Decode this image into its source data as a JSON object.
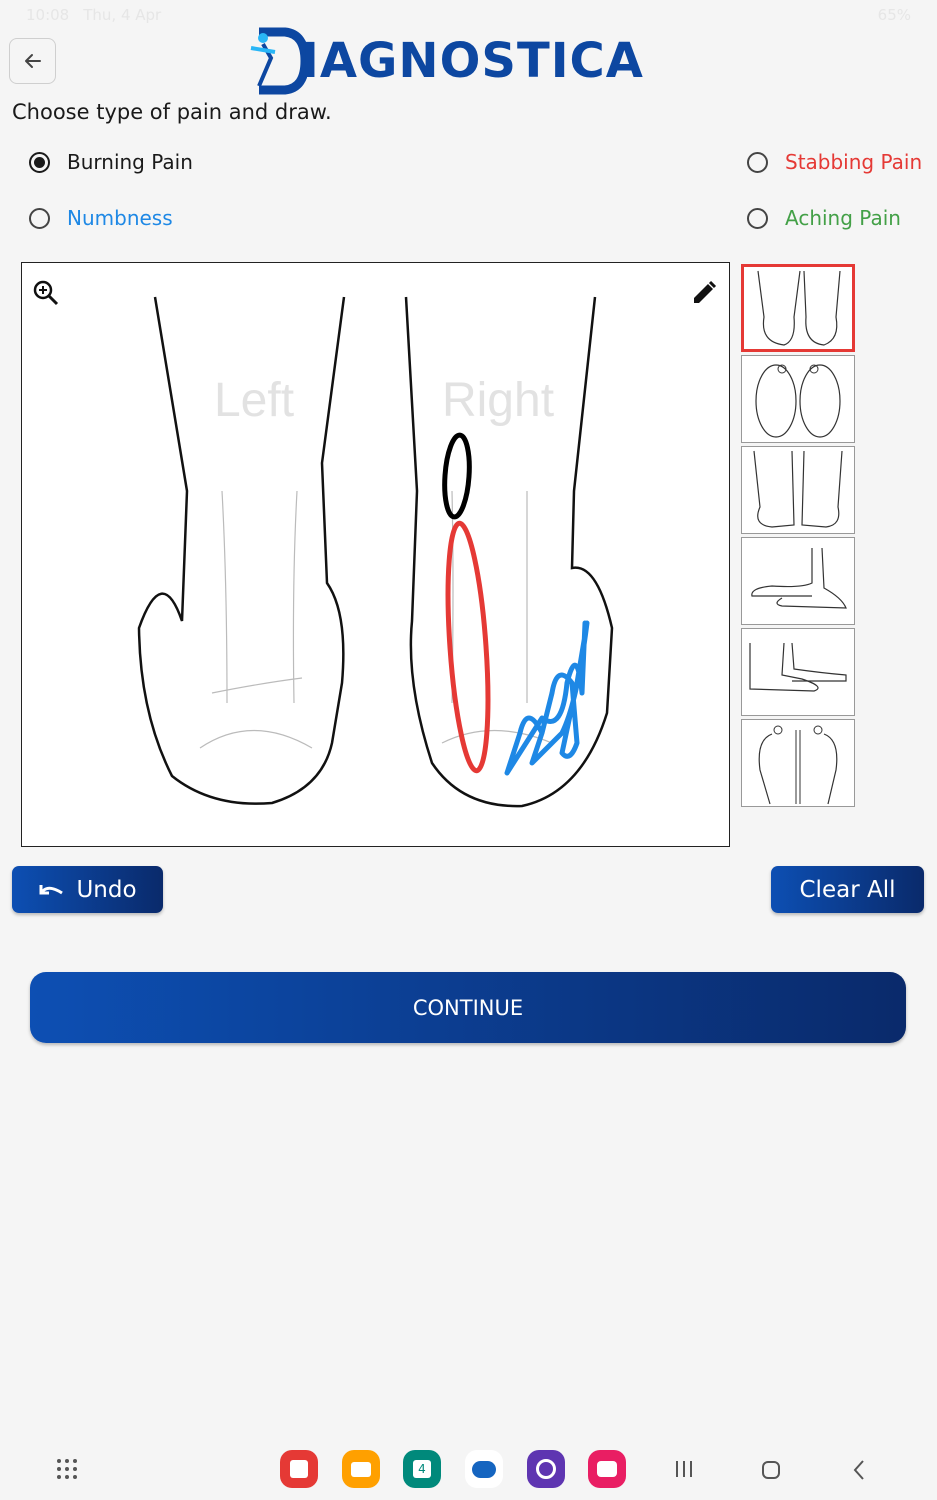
{
  "status_bar": {
    "time": "10:08",
    "date": "Thu, 4 Apr",
    "battery": "65%"
  },
  "header": {
    "logo_text": "IAGNOSTICA",
    "brand_color": "#0d47a1"
  },
  "instruction": "Choose type of pain and draw.",
  "pain_types": [
    {
      "label": "Burning Pain",
      "color": "#1a1a1a",
      "selected": true
    },
    {
      "label": "Stabbing Pain",
      "color": "#e53935",
      "selected": false
    },
    {
      "label": "Numbness",
      "color": "#1e88e5",
      "selected": false
    },
    {
      "label": "Aching Pain",
      "color": "#43a047",
      "selected": false
    }
  ],
  "canvas": {
    "left_label": "Left",
    "right_label": "Right",
    "zoom_icon": "zoom-in-icon",
    "pen_icon": "pencil-icon"
  },
  "thumbnails": [
    {
      "name": "view-back-heels",
      "selected": true
    },
    {
      "name": "view-soles",
      "selected": false
    },
    {
      "name": "view-front-top",
      "selected": false
    },
    {
      "name": "view-side-inner",
      "selected": false
    },
    {
      "name": "view-side-outer",
      "selected": false
    },
    {
      "name": "view-top-down",
      "selected": false
    }
  ],
  "buttons": {
    "undo": "Undo",
    "clear_all": "Clear All",
    "continue": "CONTINUE"
  }
}
